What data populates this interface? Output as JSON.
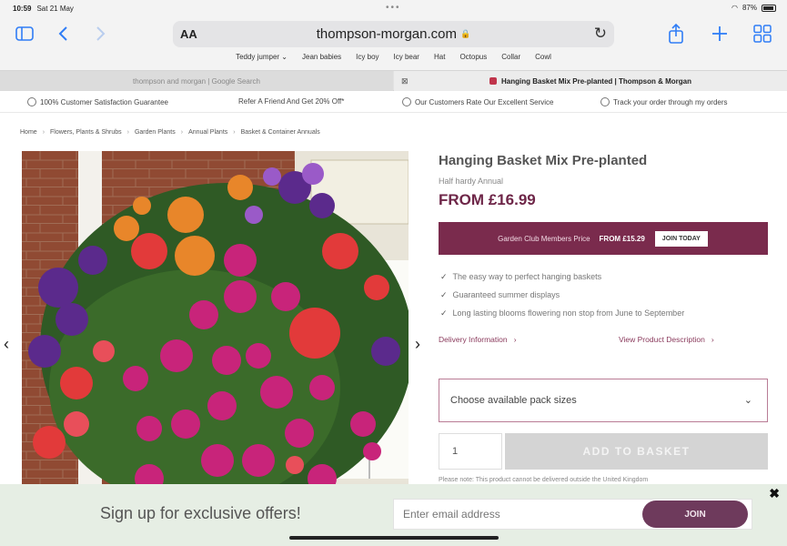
{
  "status": {
    "time": "10:59",
    "date": "Sat 21 May",
    "battery": "87%"
  },
  "toolbar": {
    "url": "thompson-morgan.com",
    "text_size": "AA"
  },
  "favorites": [
    "Teddy jumper ⌄",
    "Jean babies",
    "Icy boy",
    "Icy bear",
    "Hat",
    "Octopus",
    "Collar",
    "Cowl"
  ],
  "tabs": [
    {
      "title": "thompson and morgan | Google Search"
    },
    {
      "title": "Hanging Basket Mix Pre-planted | Thompson & Morgan"
    }
  ],
  "usp": [
    "100% Customer Satisfaction Guarantee",
    "Refer A Friend And Get 20% Off*",
    "Our Customers Rate Our Excellent Service",
    "Track your order through my orders"
  ],
  "breadcrumbs": [
    "Home",
    "Flowers, Plants & Shrubs",
    "Garden Plants",
    "Annual Plants",
    "Basket & Container Annuals"
  ],
  "product": {
    "title": "Hanging Basket Mix Pre-planted",
    "subtitle": "Half hardy Annual",
    "price": "FROM £16.99",
    "club_text": "Garden Club Members Price",
    "club_price": "FROM £15.29",
    "join_label": "JOIN TODAY",
    "benefits": [
      "The easy way to perfect hanging baskets",
      "Guaranteed summer displays",
      "Long lasting blooms flowering non stop from June to September"
    ],
    "delivery_link": "Delivery Information",
    "description_link": "View Product Description",
    "pack_select": "Choose available pack sizes",
    "quantity": "1",
    "basket_label": "ADD TO BASKET",
    "notice": "Please note: This product cannot be delivered outside the United Kingdom"
  },
  "signup": {
    "text": "Sign up for exclusive offers!",
    "placeholder": "Enter email address",
    "join_label": "JOIN"
  },
  "icons": {
    "sidebar": "sidebar-icon",
    "back": "chevron-left-icon",
    "forward": "chevron-right-icon",
    "share": "share-icon",
    "new_tab": "plus-icon",
    "tabs": "tab-grid-icon"
  },
  "colors": {
    "brand": "#7a2b4d",
    "join_button": "#6e3a5c",
    "link": "#8a3a5c",
    "safari_blue": "#2f7df6"
  }
}
